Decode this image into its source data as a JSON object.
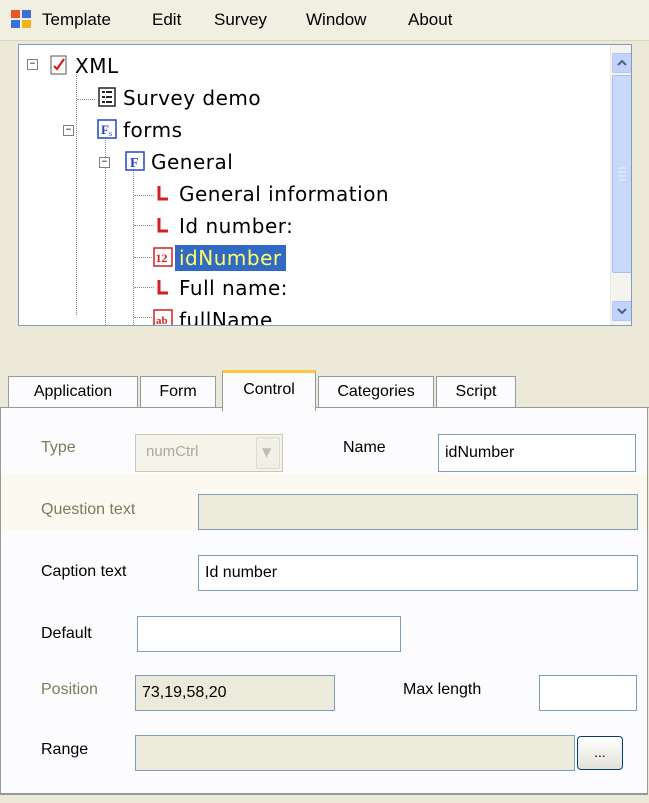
{
  "menu": {
    "items": [
      "Template",
      "Edit",
      "Survey",
      "Window",
      "About"
    ]
  },
  "tree": {
    "root": "XML",
    "survey_demo": "Survey demo",
    "forms": "forms",
    "general": "General",
    "general_information": "General information",
    "id_number_label": "Id number:",
    "id_number_ctrl": "idNumber",
    "full_name_label": "Full name:",
    "full_name_ctrl": "fullName"
  },
  "tabs": [
    "Application",
    "Form",
    "Control",
    "Categories",
    "Script"
  ],
  "active_tab": "Control",
  "form": {
    "type_label": "Type",
    "type_value": "numCtrl",
    "name_label": "Name",
    "name_value": "idNumber",
    "question_label": "Question text",
    "question_value": "",
    "caption_label": "Caption text",
    "caption_value": "Id number",
    "default_label": "Default",
    "default_value": "",
    "position_label": "Position",
    "position_value": "73,19,58,20",
    "maxlength_label": "Max length",
    "maxlength_value": "",
    "range_label": "Range",
    "range_value": "",
    "browse_label": "..."
  },
  "colors": {
    "selection": "#316ac5",
    "selection_text": "#ffff66",
    "tab_accent": "#ffc83c",
    "disabled_label": "#7d7b5a"
  }
}
